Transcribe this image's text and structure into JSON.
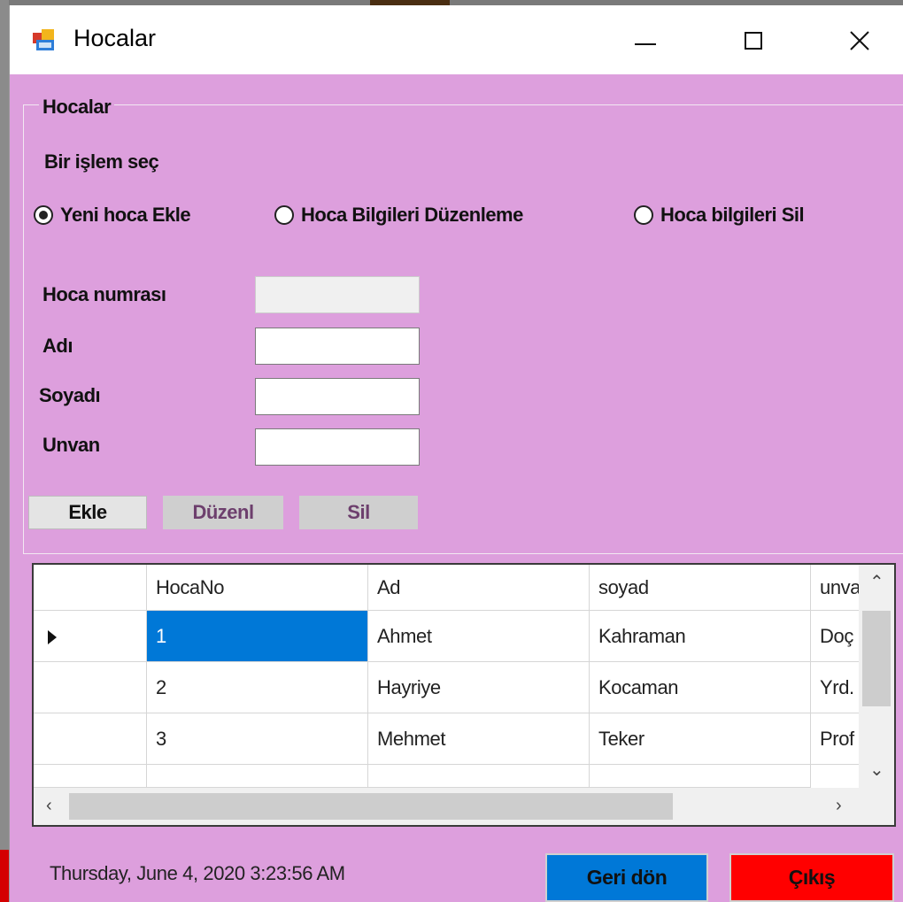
{
  "window": {
    "title": "Hocalar",
    "icon": "winforms-app-icon"
  },
  "group": {
    "title": "Hocalar",
    "prompt": "Bir işlem seç",
    "radios": [
      {
        "label": "Yeni hoca Ekle",
        "checked": true
      },
      {
        "label": "Hoca Bilgileri Düzenleme",
        "checked": false
      },
      {
        "label": "Hoca bilgileri Sil",
        "checked": false
      }
    ],
    "fields": [
      {
        "label": "Hoca numrası",
        "value": "",
        "enabled": false
      },
      {
        "label": "Adı",
        "value": "",
        "enabled": true
      },
      {
        "label": "Soyadı",
        "value": "",
        "enabled": true
      },
      {
        "label": "Unvan",
        "value": "",
        "enabled": true
      }
    ],
    "buttons": {
      "add": "Ekle",
      "edit": "Düzenl",
      "delete": "Sil"
    }
  },
  "grid": {
    "columns": [
      "HocaNo",
      "Ad",
      "soyad",
      "unvan"
    ],
    "rows": [
      [
        "1",
        "Ahmet",
        "Kahraman",
        "Doç"
      ],
      [
        "2",
        "Hayriye",
        "Kocaman",
        "Yrd."
      ],
      [
        "3",
        "Mehmet",
        "Teker",
        "Prof"
      ]
    ]
  },
  "footer": {
    "datetime": "Thursday, June 4, 2020  3:23:56 AM",
    "back_label": "Geri dön",
    "exit_label": "Çıkış"
  },
  "colors": {
    "form_bg": "#dd9fdd",
    "back_button": "#0078d7",
    "exit_button": "#ff0000",
    "selected_cell": "#0078d7"
  }
}
